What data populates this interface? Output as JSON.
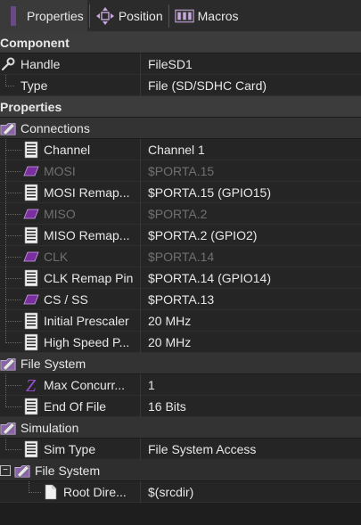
{
  "toolbar": {
    "properties_label": "Properties",
    "position_label": "Position",
    "macros_label": "Macros"
  },
  "categories": {
    "component": "Component",
    "properties": "Properties"
  },
  "component": {
    "handle": {
      "name": "Handle",
      "value": "FileSD1"
    },
    "type": {
      "name": "Type",
      "value": "File (SD/SDHC Card)"
    }
  },
  "groups": {
    "connections": "Connections",
    "file_system": "File System",
    "simulation": "Simulation",
    "sim_file_system": "File System"
  },
  "connections": [
    {
      "name": "Channel",
      "value": "Channel 1",
      "icon": "list-icon",
      "disabled": false
    },
    {
      "name": "MOSI",
      "value": "$PORTA.15",
      "icon": "pin-icon",
      "disabled": true
    },
    {
      "name": "MOSI Remap...",
      "value": "$PORTA.15 (GPIO15)",
      "icon": "list-icon",
      "disabled": false
    },
    {
      "name": "MISO",
      "value": "$PORTA.2",
      "icon": "pin-icon",
      "disabled": true
    },
    {
      "name": "MISO Remap...",
      "value": "$PORTA.2 (GPIO2)",
      "icon": "list-icon",
      "disabled": false
    },
    {
      "name": "CLK",
      "value": "$PORTA.14",
      "icon": "pin-icon",
      "disabled": true
    },
    {
      "name": "CLK Remap Pin",
      "value": "$PORTA.14 (GPIO14)",
      "icon": "list-icon",
      "disabled": false
    },
    {
      "name": "CS / SS",
      "value": "$PORTA.13",
      "icon": "pin-icon",
      "disabled": false
    },
    {
      "name": "Initial Prescaler",
      "value": "20 MHz",
      "icon": "list-icon",
      "disabled": false
    },
    {
      "name": "High Speed P...",
      "value": "20 MHz",
      "icon": "list-icon",
      "disabled": false
    }
  ],
  "file_system": [
    {
      "name": "Max Concurr...",
      "value": "1",
      "icon": "number-z-icon"
    },
    {
      "name": "End Of File",
      "value": "16 Bits",
      "icon": "list-icon"
    }
  ],
  "simulation": [
    {
      "name": "Sim Type",
      "value": "File System Access",
      "icon": "list-icon"
    }
  ],
  "sim_file_system": {
    "expander": "−",
    "root_dir": {
      "name": "Root Dire...",
      "value": "$(srcdir)"
    }
  },
  "colors": {
    "pin_purple": "#7a2ea0",
    "background": "#1e1e1e",
    "disabled_text": "#707070"
  }
}
